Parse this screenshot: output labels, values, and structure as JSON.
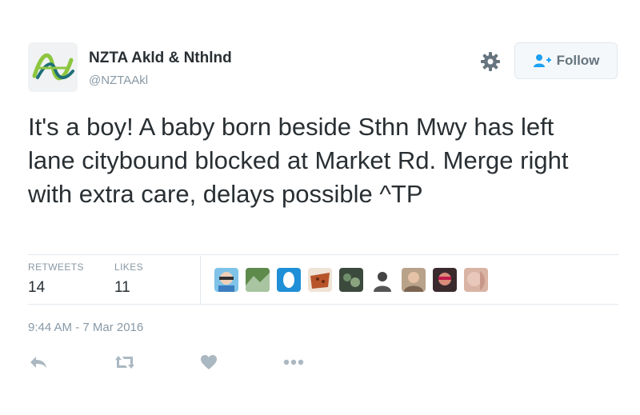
{
  "account": {
    "name": "NZTA Akld & Nthlnd",
    "handle": "@NZTAAkl",
    "avatar_icon": "nzta-logo-icon"
  },
  "header": {
    "settings_icon": "gear-icon",
    "follow_label": "Follow",
    "follow_icon": "add-user-icon"
  },
  "tweet": {
    "text": "It's a boy! A baby born beside Sthn Mwy has left lane citybound blocked at Market Rd. Merge right with extra care, delays possible ^TP",
    "timestamp": "9:44 AM - 7 Mar 2016"
  },
  "stats": {
    "retweets_label": "RETWEETS",
    "retweets_count": "14",
    "likes_label": "LIKES",
    "likes_count": "11"
  },
  "likers": [
    "avatar-1",
    "avatar-2",
    "avatar-3",
    "avatar-4",
    "avatar-5",
    "avatar-6",
    "avatar-7",
    "avatar-8",
    "avatar-9"
  ],
  "actions": [
    "reply-icon",
    "retweet-icon",
    "like-heart-icon",
    "more-icon"
  ],
  "colors": {
    "text": "#292f33",
    "muted": "#8899a6",
    "border": "#e1e8ed",
    "follow_icon": "#1da1f2",
    "logo_green": "#8dc63f",
    "logo_teal": "#1f6f78"
  }
}
